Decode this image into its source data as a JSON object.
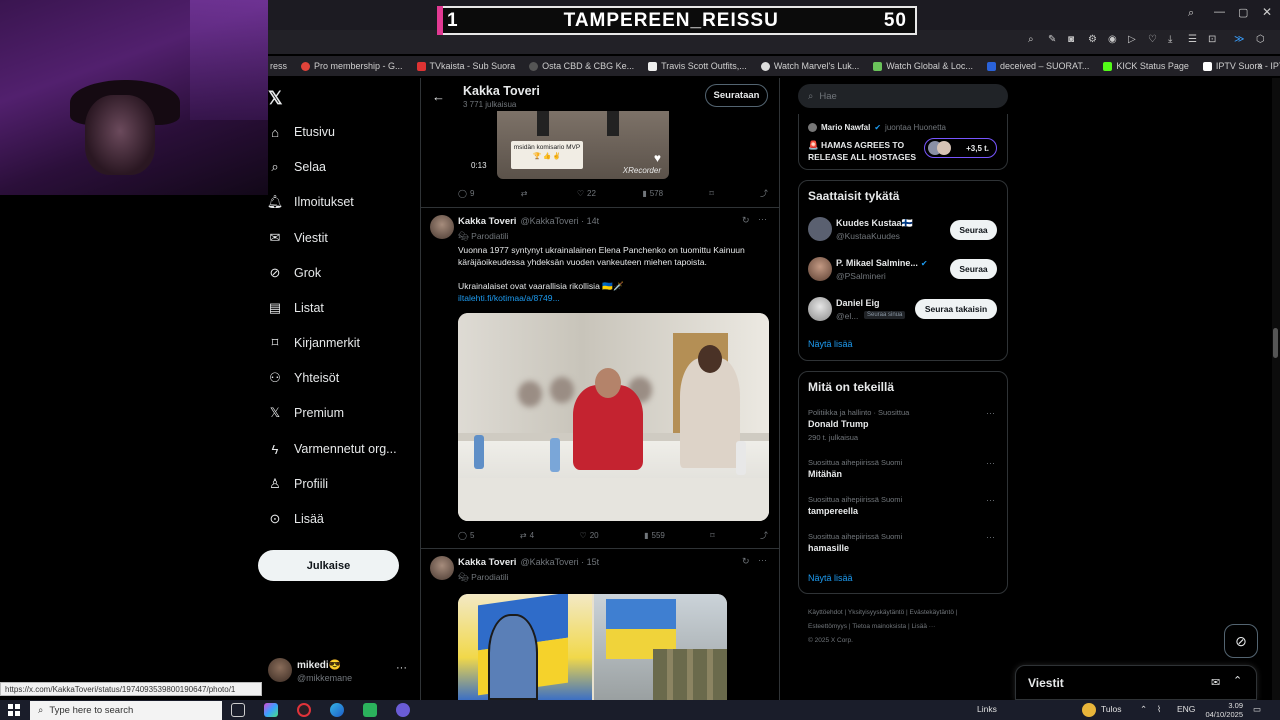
{
  "overlay": {
    "score_left": "1",
    "title": "TAMPEREEN_REISSU",
    "score_right": "50"
  },
  "bookmarks": [
    "ress",
    "Pro membership - G...",
    "TVkaista - Sub Suora",
    "Osta CBD & CBG Ke...",
    "Travis Scott Outfits,...",
    "Watch Marvel's Luk...",
    "Watch Global & Loc...",
    "deceived – SUORAT...",
    "KICK Status Page",
    "IPTV Suora - IPTV u..."
  ],
  "nav": {
    "items": [
      {
        "label": "Etusivu",
        "icon": "home-icon"
      },
      {
        "label": "Selaa",
        "icon": "search-icon"
      },
      {
        "label": "Ilmoitukset",
        "icon": "bell-icon"
      },
      {
        "label": "Viestit",
        "icon": "mail-icon"
      },
      {
        "label": "Grok",
        "icon": "grok-icon"
      },
      {
        "label": "Listat",
        "icon": "list-icon"
      },
      {
        "label": "Kirjanmerkit",
        "icon": "bookmark-icon"
      },
      {
        "label": "Yhteisöt",
        "icon": "communities-icon"
      },
      {
        "label": "Premium",
        "icon": "x-icon"
      },
      {
        "label": "Varmennetut org...",
        "icon": "lightning-icon"
      },
      {
        "label": "Profiili",
        "icon": "person-icon"
      },
      {
        "label": "Lisää",
        "icon": "more-circle-icon"
      }
    ],
    "post_button": "Julkaise"
  },
  "account": {
    "name": "mikedi😎",
    "handle": "@mikkemane"
  },
  "status_url": "https://x.com/KakkaToveri/status/1974093539800190647/photo/1",
  "header": {
    "title": "Kakka Toveri",
    "subtitle": "3 771 julkaisua",
    "follow_button": "Seurataan"
  },
  "video": {
    "time": "0:13",
    "caption": "msidän komisario MVP 🏆 👍 ✌",
    "watermark": "XRecorder",
    "actions": {
      "replies": "9",
      "reposts": "",
      "likes": "22",
      "views": "578"
    }
  },
  "posts": [
    {
      "name": "Kakka Toveri",
      "handle": "@KakkaToveri · 14t",
      "badge": "Parodiatili",
      "text1": "Vuonna 1977 syntynyt ukrainalainen Elena Panchenko on tuomittu Kainuun käräjäoikeudessa yhdeksän vuoden vankeuteen miehen tapoista.",
      "text2": "Ukrainalaiset ovat vaarallisia rikollisia 🇺🇦🗡️",
      "link": "iltalehti.fi/kotimaa/a/8749...",
      "actions": {
        "replies": "5",
        "reposts": "4",
        "likes": "20",
        "views": "559"
      }
    },
    {
      "name": "Kakka Toveri",
      "handle": "@KakkaToveri · 15t",
      "badge": "Parodiatili"
    }
  ],
  "right": {
    "search_placeholder": "Hae",
    "live": {
      "name": "Mario Nawfal",
      "status": "juontaa Huonetta",
      "headline": "🚨 HAMAS AGREES TO RELEASE ALL HOSTAGES",
      "listeners": "+3,5 t."
    },
    "suggestions_title": "Saattaisit tykätä",
    "suggestions": [
      {
        "name": "Kuudes Kustaa🇫🇮",
        "handle": "@KustaaKuudes",
        "button": "Seuraa"
      },
      {
        "name": "P. Mikael Salmine...",
        "handle": "@PSalmineri",
        "button": "Seuraa"
      },
      {
        "name": "Daniel Eig",
        "handle": "@el...",
        "tag": "Seuraa sinua",
        "button": "Seuraa takaisin"
      }
    ],
    "suggestions_more": "Näytä lisää",
    "trends_title": "Mitä on tekeillä",
    "trends": [
      {
        "meta": "Politiikka ja hallinto · Suosittua",
        "name": "Donald Trump",
        "count": "290 t. julkaisua"
      },
      {
        "meta": "Suosittua aihepiirissä Suomi",
        "name": "Mitähän",
        "count": ""
      },
      {
        "meta": "Suosittua aihepiirissä Suomi",
        "name": "tampereella",
        "count": ""
      },
      {
        "meta": "Suosittua aihepiirissä Suomi",
        "name": "hamasille",
        "count": ""
      }
    ],
    "trends_more": "Näytä lisää",
    "footer_line1": "Käyttöehdot | Yksityisyyskäytäntö | Evästekäytäntö |",
    "footer_line2": "Esteettömyys | Tietoa mainoksista | Lisää ···",
    "footer_line3": "© 2025 X Corp."
  },
  "messages_bar": "Viestit",
  "taskbar": {
    "search": "Type here to search",
    "links": "Links",
    "weather": "Tulos",
    "lang": "ENG",
    "time": "3.09",
    "date": "04/10/2025"
  }
}
